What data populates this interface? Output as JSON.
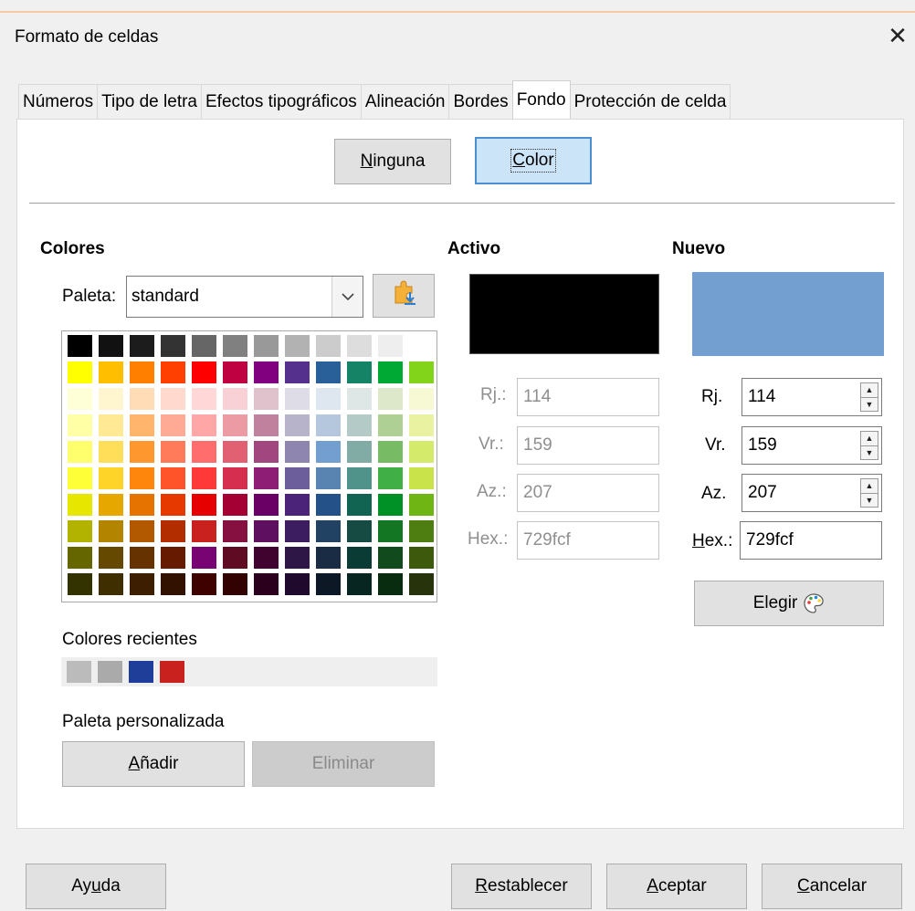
{
  "dialog": {
    "title": "Formato de celdas",
    "close_glyph": "✕"
  },
  "tabs": [
    {
      "label": "Números"
    },
    {
      "label": "Tipo de letra"
    },
    {
      "label": "Efectos tipográficos"
    },
    {
      "label": "Alineación"
    },
    {
      "label": "Bordes"
    },
    {
      "label": "Fondo",
      "active": true
    },
    {
      "label": "Protección de celda"
    }
  ],
  "fill_mode": {
    "none_label": "Ninguna",
    "none_mnemonic": "N",
    "color_label": "Color",
    "color_mnemonic": "C",
    "selected": "Color"
  },
  "colors": {
    "heading": "Colores",
    "palette_label": "Paleta:",
    "palette_value": "standard",
    "grid": [
      [
        "#000000",
        "#111111",
        "#1c1c1c",
        "#333333",
        "#666666",
        "#808080",
        "#999999",
        "#b2b2b2",
        "#cccccc",
        "#dddddd",
        "#eeeeee",
        "#ffffff"
      ],
      [
        "#ffff00",
        "#ffbf00",
        "#ff8000",
        "#ff4000",
        "#ff0000",
        "#bf0041",
        "#800080",
        "#55308d",
        "#2a6099",
        "#158466",
        "#00a933",
        "#81d41a"
      ],
      [
        "#ffffd7",
        "#fff5ce",
        "#ffdbb6",
        "#ffd8ce",
        "#ffd7d7",
        "#f7d1d5",
        "#e0c2cd",
        "#dedce6",
        "#dee6ef",
        "#dee7e5",
        "#dde8cb",
        "#f6f9d4"
      ],
      [
        "#ffffa6",
        "#ffe994",
        "#ffb66c",
        "#ffaa95",
        "#ffa6a6",
        "#ec9ba4",
        "#bf819e",
        "#b7b3ca",
        "#b4c7dc",
        "#b3cac7",
        "#afd095",
        "#e8f2a1"
      ],
      [
        "#ffff6d",
        "#ffde59",
        "#ff972f",
        "#ff7b59",
        "#ff6d6d",
        "#e16173",
        "#a1467e",
        "#8e86ae",
        "#729fcf",
        "#81aca6",
        "#77bc65",
        "#d4ea6b"
      ],
      [
        "#ffff38",
        "#ffd428",
        "#ff860d",
        "#ff5429",
        "#ff3838",
        "#d62e4e",
        "#8d1d75",
        "#6b5e9b",
        "#5983b0",
        "#50938a",
        "#3faf46",
        "#c9e34b"
      ],
      [
        "#e6e600",
        "#e6a700",
        "#e67300",
        "#e63900",
        "#e60000",
        "#a50034",
        "#6a0066",
        "#4b2378",
        "#245187",
        "#116452",
        "#009126",
        "#6fb514"
      ],
      [
        "#b2b200",
        "#b28400",
        "#b25900",
        "#b22d00",
        "#c9211e",
        "#861141",
        "#5f0f5f",
        "#3c1d5f",
        "#224264",
        "#164b43",
        "#127622",
        "#4e7d11"
      ],
      [
        "#666600",
        "#664900",
        "#663300",
        "#661a00",
        "#780373",
        "#5f0b24",
        "#400330",
        "#2e1646",
        "#1a2c44",
        "#0a3c35",
        "#114a1c",
        "#3d5a0c"
      ],
      [
        "#333300",
        "#3f2e00",
        "#3d1f00",
        "#331100",
        "#3f0000",
        "#320101",
        "#2b001c",
        "#1f0a2d",
        "#0d1826",
        "#072622",
        "#072c10",
        "#26330b"
      ]
    ],
    "recent_label": "Colores recientes",
    "recent": [
      "#bbbbbb",
      "#aaaaaa",
      "#1f3e9a",
      "#c9211e"
    ],
    "custom_label": "Paleta personalizada",
    "add_label": "Añadir",
    "delete_label": "Eliminar"
  },
  "active": {
    "heading": "Activo",
    "color": "#000000",
    "r_label": "Rj.:",
    "r": "114",
    "g_label": "Vr.:",
    "g": "159",
    "b_label": "Az.:",
    "b": "207",
    "hex_label": "Hex.:",
    "hex": "729fcf"
  },
  "new": {
    "heading": "Nuevo",
    "color": "#729fcf",
    "r_label": "Rj.",
    "r": "114",
    "g_label": "Vr.",
    "g": "159",
    "b_label": "Az.",
    "b": "207",
    "hex_label": "Hex.:",
    "hex": "729fcf",
    "pick_label": "Elegir"
  },
  "footer": {
    "help": "Ayuda",
    "reset": "Restablecer",
    "ok": "Aceptar",
    "cancel": "Cancelar"
  }
}
